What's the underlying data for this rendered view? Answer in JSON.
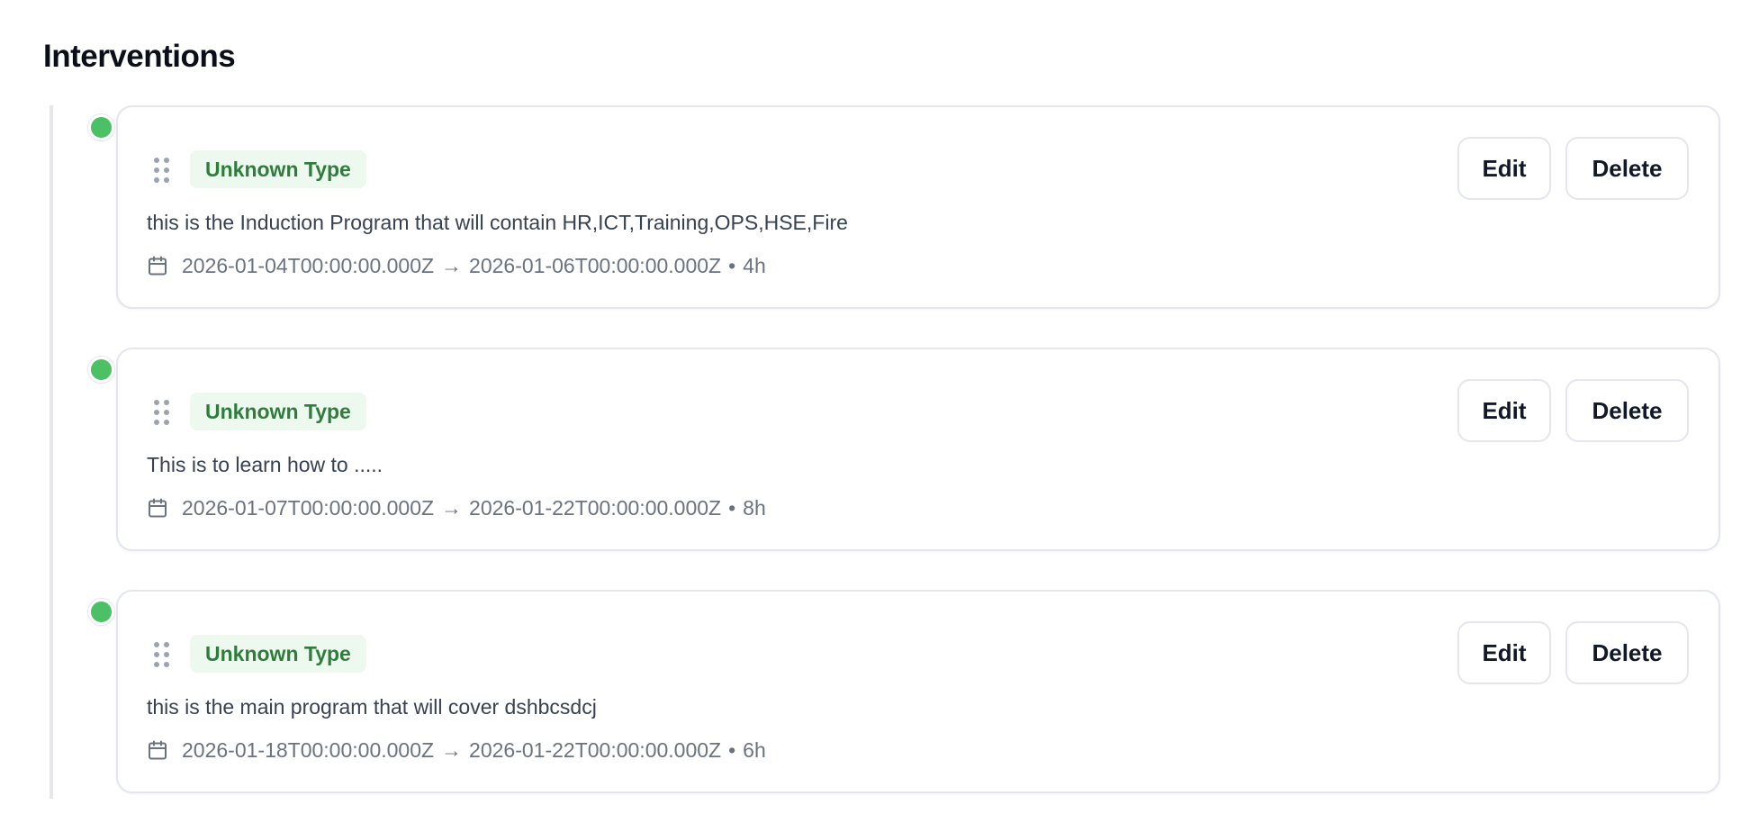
{
  "page": {
    "title": "Interventions"
  },
  "status_color": "#4cc065",
  "badge_color": "#2f7d3c",
  "interventions": [
    {
      "type": "Unknown Type",
      "description": "this is the Induction Program that will contain HR,ICT,Training,OPS,HSE,Fire",
      "start": "2026-01-04T00:00:00.000Z",
      "end": "2026-01-06T00:00:00.000Z",
      "duration": "4h",
      "edit_label": "Edit",
      "delete_label": "Delete",
      "icon": "calendar-icon"
    },
    {
      "type": "Unknown Type",
      "description": "This is to learn how to .....",
      "start": "2026-01-07T00:00:00.000Z",
      "end": "2026-01-22T00:00:00.000Z",
      "duration": "8h",
      "edit_label": "Edit",
      "delete_label": "Delete",
      "icon": "calendar-icon"
    },
    {
      "type": "Unknown Type",
      "description": "this is the main program that will cover dshbcsdcj",
      "start": "2026-01-18T00:00:00.000Z",
      "end": "2026-01-22T00:00:00.000Z",
      "duration": "6h",
      "edit_label": "Edit",
      "delete_label": "Delete",
      "icon": "calendar-icon"
    }
  ],
  "separators": {
    "arrow": "→",
    "bullet": "•"
  }
}
